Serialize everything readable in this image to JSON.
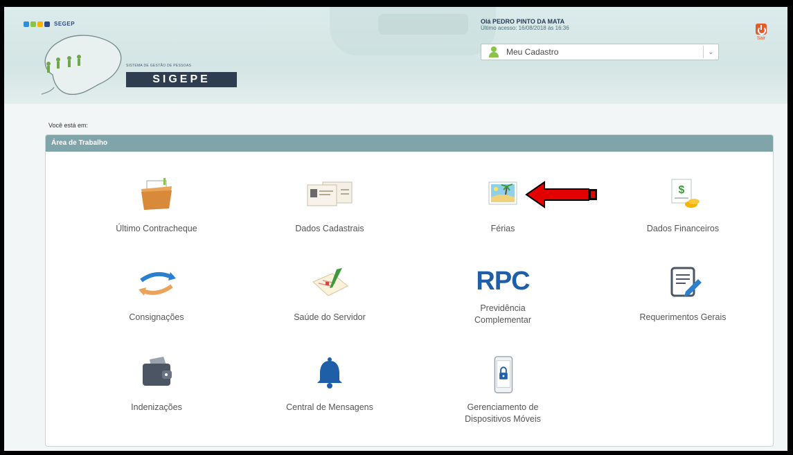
{
  "header": {
    "brand": "SEGEP",
    "system_name": "SISTEMA DE GESTÃO DE PESSOAS",
    "system_logo_text": "SIGEPE",
    "greeting": "Olá PEDRO PINTO DA MATA",
    "last_access": "Último acesso: 16/08/2018 às 16:36",
    "profile_select": "Meu Cadastro",
    "exit_label": "Sair"
  },
  "breadcrumb": "Você está em:",
  "workarea": {
    "title": "Área de Trabalho",
    "tiles": [
      {
        "label": "Último Contracheque",
        "icon": "folder-icon"
      },
      {
        "label": "Dados Cadastrais",
        "icon": "id-cards-icon"
      },
      {
        "label": "Férias",
        "icon": "beach-picture-icon"
      },
      {
        "label": "Dados Financeiros",
        "icon": "money-icon"
      },
      {
        "label": "Consignações",
        "icon": "refresh-arrows-icon"
      },
      {
        "label": "Saúde do Servidor",
        "icon": "health-report-icon"
      },
      {
        "label": "Previdência Complementar",
        "icon": "rpc-icon",
        "icon_text": "RPC"
      },
      {
        "label": "Requerimentos Gerais",
        "icon": "document-edit-icon"
      },
      {
        "label": "Indenizações",
        "icon": "wallet-icon"
      },
      {
        "label": "Central de Mensagens",
        "icon": "bell-icon"
      },
      {
        "label": "Gerenciamento de Dispositivos Móveis",
        "icon": "mobile-lock-icon"
      }
    ]
  },
  "colors": {
    "header_bg": "#d6e7e6",
    "panel_header": "#7fa5aa",
    "logo_box": "#2e3d4f",
    "accent_orange": "#e55a2b",
    "rpc_blue": "#1f5fa8",
    "annotation_arrow": "#e30000"
  }
}
